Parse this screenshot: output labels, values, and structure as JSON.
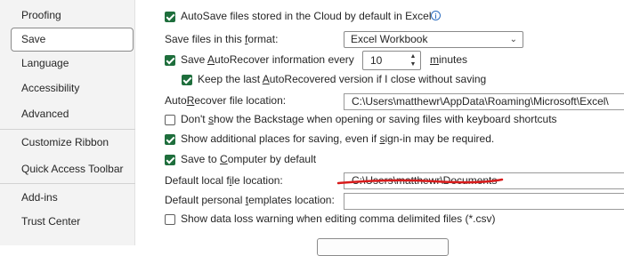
{
  "sidebar": {
    "items": [
      {
        "label": "Proofing"
      },
      {
        "label": "Save"
      },
      {
        "label": "Language"
      },
      {
        "label": "Accessibility"
      },
      {
        "label": "Advanced"
      },
      {
        "label": "Customize Ribbon"
      },
      {
        "label": "Quick Access Toolbar"
      },
      {
        "label": "Add-ins"
      },
      {
        "label": "Trust Center"
      }
    ],
    "selected": "Save"
  },
  "options": {
    "autosave_cloud": {
      "label": "AutoSave files stored in the Cloud by default in Excel",
      "checked": true
    },
    "save_format": {
      "label_pre": "Save files in this ",
      "label_u": "f",
      "label_post": "ormat:",
      "value": "Excel Workbook"
    },
    "autorecover": {
      "label_pre": "Save ",
      "label_u": "A",
      "label_post": "utoRecover information every",
      "checked": true,
      "minutes": "10",
      "minutes_pre": "",
      "minutes_u": "m",
      "minutes_post": "inutes"
    },
    "keep_last": {
      "label_pre": "Keep the last ",
      "label_u": "A",
      "label_post": "utoRecovered version if I close without saving",
      "checked": true
    },
    "autorecover_location": {
      "label_pre": "Auto",
      "label_u": "R",
      "label_post": "ecover file location:",
      "value": "C:\\Users\\matthewr\\AppData\\Roaming\\Microsoft\\Excel\\"
    },
    "backstage": {
      "label_pre": "Don't ",
      "label_u": "s",
      "label_post": "how the Backstage when opening or saving files with keyboard shortcuts",
      "checked": false
    },
    "additional_places": {
      "label_pre": "Show additional places for saving, even if ",
      "label_u": "s",
      "label_post": "ign-in may be required.",
      "checked": true
    },
    "save_to_computer": {
      "label_pre": "Save to ",
      "label_u": "C",
      "label_post": "omputer by default",
      "checked": true
    },
    "default_local": {
      "label_pre": "Default local f",
      "label_u": "i",
      "label_post": "le location:",
      "value": "C:\\Users\\matthewr\\Documents"
    },
    "personal_templates": {
      "label_pre": "Default personal ",
      "label_u": "t",
      "label_post": "emplates location:",
      "value": ""
    },
    "data_loss": {
      "label": "Show data loss warning when editing comma delimited files (*.csv)",
      "checked": false
    }
  },
  "colors": {
    "check": "#1e6e3c",
    "annotation": "#d81b1b",
    "info": "#2f6fc0"
  }
}
